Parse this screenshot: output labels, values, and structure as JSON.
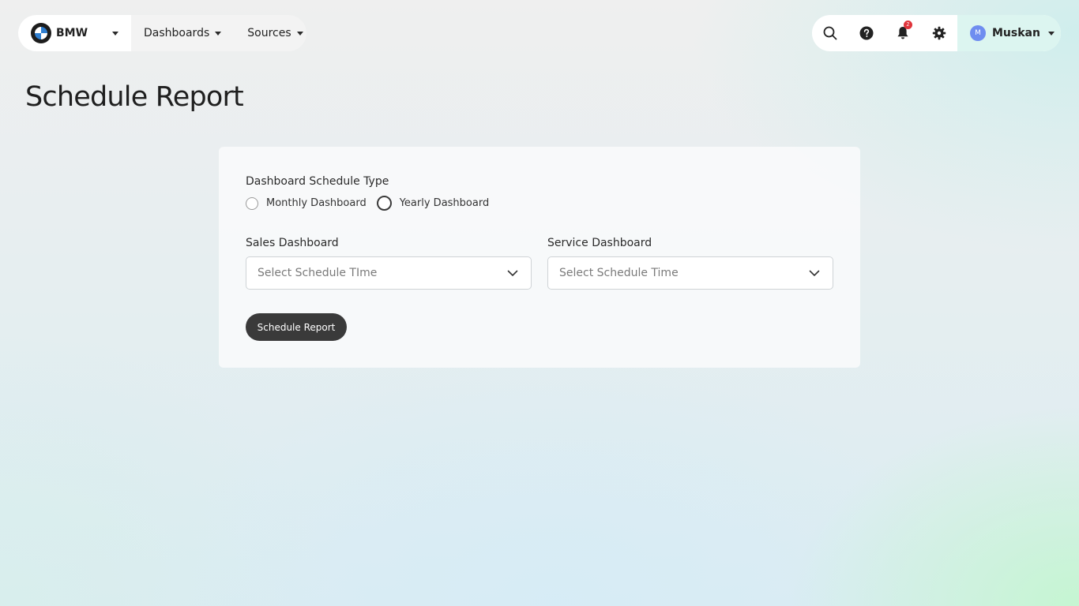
{
  "nav": {
    "brand": {
      "name": "BMW",
      "logo_icon": "bmw-logo-icon"
    },
    "items": [
      {
        "label": "Dashboards"
      },
      {
        "label": "Sources"
      }
    ]
  },
  "toolbar": {
    "icons": [
      "search-icon",
      "help-icon",
      "bell-icon",
      "gear-icon"
    ],
    "notification_count": "2",
    "user": {
      "initial": "M",
      "name": "Muskan"
    }
  },
  "page": {
    "title": "Schedule Report"
  },
  "form": {
    "schedule_type_label": "Dashboard Schedule Type",
    "schedule_types": [
      {
        "label": "Monthly Dashboard",
        "selected": false
      },
      {
        "label": "Yearly Dashboard",
        "selected": false
      }
    ],
    "sales": {
      "label": "Sales Dashboard",
      "placeholder": "Select Schedule TIme"
    },
    "service": {
      "label": "Service Dashboard",
      "placeholder": "Select Schedule Time"
    },
    "submit_label": "Schedule Report"
  },
  "colors": {
    "primary_button": "#3a3a3a",
    "user_chip": "#dcf5f0",
    "avatar": "#6f8df0",
    "badge": "#e0343b"
  }
}
